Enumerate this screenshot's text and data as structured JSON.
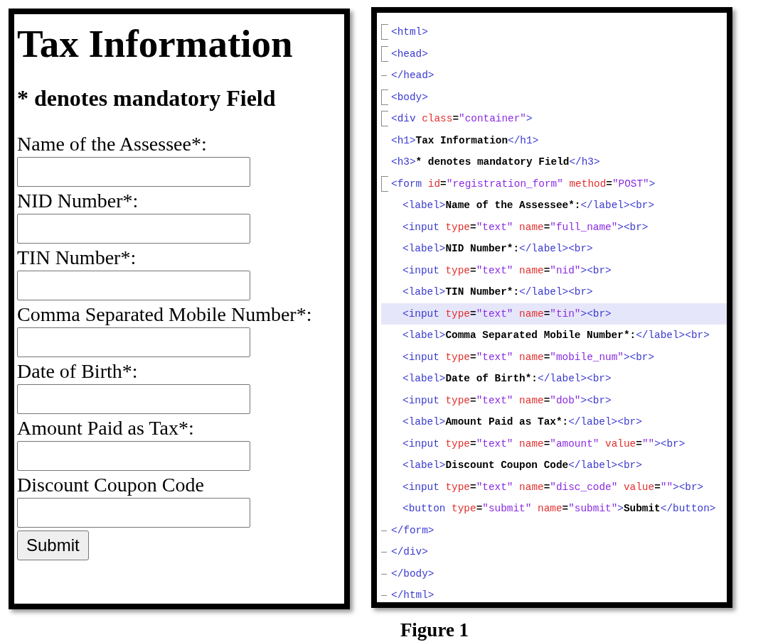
{
  "form_preview": {
    "title": "Tax Information",
    "subtitle": "* denotes mandatory Field",
    "fields": [
      {
        "label": "Name of the Assessee*:"
      },
      {
        "label": "NID Number*:"
      },
      {
        "label": "TIN Number*:"
      },
      {
        "label": "Comma Separated Mobile Number*:"
      },
      {
        "label": "Date of Birth*:"
      },
      {
        "label": "Amount Paid as Tax*:"
      },
      {
        "label": "Discount Coupon Code"
      }
    ],
    "submit_button": "Submit"
  },
  "code_editor": {
    "lines": [
      {
        "kind": "fold-start",
        "highlighted": false,
        "tokens": [
          {
            "kind": "tag",
            "text": "<html>"
          }
        ]
      },
      {
        "kind": "fold-start",
        "highlighted": false,
        "tokens": [
          {
            "kind": "tag",
            "text": "<head>"
          }
        ]
      },
      {
        "kind": "fold-end",
        "highlighted": false,
        "tokens": [
          {
            "kind": "tag",
            "text": "</head>"
          }
        ]
      },
      {
        "kind": "fold-start",
        "highlighted": false,
        "tokens": [
          {
            "kind": "tag",
            "text": "<body>"
          }
        ]
      },
      {
        "kind": "fold-start",
        "highlighted": false,
        "tokens": [
          {
            "kind": "tag",
            "text": "<div"
          },
          {
            "kind": "attr",
            "text": " class"
          },
          {
            "kind": "text",
            "text": "="
          },
          {
            "kind": "value",
            "text": "\"container\""
          },
          {
            "kind": "tag",
            "text": ">"
          }
        ]
      },
      {
        "highlighted": false,
        "tokens": [
          {
            "kind": "tag",
            "text": "<h1>"
          },
          {
            "kind": "text",
            "text": "Tax Information"
          },
          {
            "kind": "tag",
            "text": "</h1>"
          }
        ]
      },
      {
        "highlighted": false,
        "tokens": [
          {
            "kind": "tag",
            "text": "<h3>"
          },
          {
            "kind": "text",
            "text": "* denotes mandatory Field"
          },
          {
            "kind": "tag",
            "text": "</h3>"
          }
        ]
      },
      {
        "kind": "fold-start",
        "highlighted": false,
        "tokens": [
          {
            "kind": "tag",
            "text": "<form"
          },
          {
            "kind": "attr",
            "text": " id"
          },
          {
            "kind": "text",
            "text": "="
          },
          {
            "kind": "value",
            "text": "\"registration_form\""
          },
          {
            "kind": "attr",
            "text": " method"
          },
          {
            "kind": "text",
            "text": "="
          },
          {
            "kind": "value",
            "text": "\"POST\""
          },
          {
            "kind": "tag",
            "text": ">"
          }
        ],
        "children": [
          {
            "highlighted": false,
            "tokens": [
              {
                "kind": "tag",
                "text": "<label>"
              },
              {
                "kind": "text",
                "text": "Name of the Assessee*:"
              },
              {
                "kind": "tag",
                "text": "</label><br>"
              }
            ]
          },
          {
            "highlighted": false,
            "tokens": [
              {
                "kind": "tag",
                "text": "<input"
              },
              {
                "kind": "attr",
                "text": " type"
              },
              {
                "kind": "text",
                "text": "="
              },
              {
                "kind": "value",
                "text": "\"text\""
              },
              {
                "kind": "attr",
                "text": " name"
              },
              {
                "kind": "text",
                "text": "="
              },
              {
                "kind": "value",
                "text": "\"full_name\""
              },
              {
                "kind": "tag",
                "text": "><br>"
              }
            ]
          },
          {
            "highlighted": false,
            "tokens": [
              {
                "kind": "tag",
                "text": "<label>"
              },
              {
                "kind": "text",
                "text": "NID Number*:"
              },
              {
                "kind": "tag",
                "text": "</label><br>"
              }
            ]
          },
          {
            "highlighted": false,
            "tokens": [
              {
                "kind": "tag",
                "text": "<input"
              },
              {
                "kind": "attr",
                "text": " type"
              },
              {
                "kind": "text",
                "text": "="
              },
              {
                "kind": "value",
                "text": "\"text\""
              },
              {
                "kind": "attr",
                "text": " name"
              },
              {
                "kind": "text",
                "text": "="
              },
              {
                "kind": "value",
                "text": "\"nid\""
              },
              {
                "kind": "tag",
                "text": "><br>"
              }
            ]
          },
          {
            "highlighted": false,
            "tokens": [
              {
                "kind": "tag",
                "text": "<label>"
              },
              {
                "kind": "text",
                "text": "TIN Number*:"
              },
              {
                "kind": "tag",
                "text": "</label><br>"
              }
            ]
          },
          {
            "highlighted": true,
            "tokens": [
              {
                "kind": "tag",
                "text": "<input"
              },
              {
                "kind": "attr",
                "text": " type"
              },
              {
                "kind": "text",
                "text": "="
              },
              {
                "kind": "value",
                "text": "\"text\""
              },
              {
                "kind": "attr",
                "text": " name"
              },
              {
                "kind": "text",
                "text": "="
              },
              {
                "kind": "value",
                "text": "\"tin\""
              },
              {
                "kind": "tag",
                "text": "><br>"
              }
            ]
          },
          {
            "highlighted": false,
            "tokens": [
              {
                "kind": "tag",
                "text": "<label>"
              },
              {
                "kind": "text",
                "text": "Comma Separated Mobile Number*:"
              },
              {
                "kind": "tag",
                "text": "</label><br>"
              }
            ]
          },
          {
            "highlighted": false,
            "tokens": [
              {
                "kind": "tag",
                "text": "<input"
              },
              {
                "kind": "attr",
                "text": " type"
              },
              {
                "kind": "text",
                "text": "="
              },
              {
                "kind": "value",
                "text": "\"text\""
              },
              {
                "kind": "attr",
                "text": " name"
              },
              {
                "kind": "text",
                "text": "="
              },
              {
                "kind": "value",
                "text": "\"mobile_num\""
              },
              {
                "kind": "tag",
                "text": "><br>"
              }
            ]
          },
          {
            "highlighted": false,
            "tokens": [
              {
                "kind": "tag",
                "text": "<label>"
              },
              {
                "kind": "text",
                "text": "Date of Birth*:"
              },
              {
                "kind": "tag",
                "text": "</label><br>"
              }
            ]
          },
          {
            "highlighted": false,
            "tokens": [
              {
                "kind": "tag",
                "text": "<input"
              },
              {
                "kind": "attr",
                "text": " type"
              },
              {
                "kind": "text",
                "text": "="
              },
              {
                "kind": "value",
                "text": "\"text\""
              },
              {
                "kind": "attr",
                "text": " name"
              },
              {
                "kind": "text",
                "text": "="
              },
              {
                "kind": "value",
                "text": "\"dob\""
              },
              {
                "kind": "tag",
                "text": "><br>"
              }
            ]
          },
          {
            "highlighted": false,
            "tokens": [
              {
                "kind": "tag",
                "text": "<label>"
              },
              {
                "kind": "text",
                "text": "Amount Paid as Tax*:"
              },
              {
                "kind": "tag",
                "text": "</label><br>"
              }
            ]
          },
          {
            "highlighted": false,
            "tokens": [
              {
                "kind": "tag",
                "text": "<input"
              },
              {
                "kind": "attr",
                "text": " type"
              },
              {
                "kind": "text",
                "text": "="
              },
              {
                "kind": "value",
                "text": "\"text\""
              },
              {
                "kind": "attr",
                "text": " name"
              },
              {
                "kind": "text",
                "text": "="
              },
              {
                "kind": "value",
                "text": "\"amount\""
              },
              {
                "kind": "attr",
                "text": " value"
              },
              {
                "kind": "text",
                "text": "="
              },
              {
                "kind": "value",
                "text": "\"\""
              },
              {
                "kind": "tag",
                "text": "><br>"
              }
            ]
          },
          {
            "highlighted": false,
            "tokens": [
              {
                "kind": "tag",
                "text": "<label>"
              },
              {
                "kind": "text",
                "text": "Discount Coupon Code"
              },
              {
                "kind": "tag",
                "text": "</label><br>"
              }
            ]
          },
          {
            "highlighted": false,
            "tokens": [
              {
                "kind": "tag",
                "text": "<input"
              },
              {
                "kind": "attr",
                "text": " type"
              },
              {
                "kind": "text",
                "text": "="
              },
              {
                "kind": "value",
                "text": "\"text\""
              },
              {
                "kind": "attr",
                "text": " name"
              },
              {
                "kind": "text",
                "text": "="
              },
              {
                "kind": "value",
                "text": "\"disc_code\""
              },
              {
                "kind": "attr",
                "text": " value"
              },
              {
                "kind": "text",
                "text": "="
              },
              {
                "kind": "value",
                "text": "\"\""
              },
              {
                "kind": "tag",
                "text": "><br>"
              }
            ]
          },
          {
            "highlighted": false,
            "tokens": [
              {
                "kind": "tag",
                "text": "<button"
              },
              {
                "kind": "attr",
                "text": " type"
              },
              {
                "kind": "text",
                "text": "="
              },
              {
                "kind": "value",
                "text": "\"submit\""
              },
              {
                "kind": "attr",
                "text": " name"
              },
              {
                "kind": "text",
                "text": "="
              },
              {
                "kind": "value",
                "text": "\"submit\""
              },
              {
                "kind": "tag",
                "text": ">"
              },
              {
                "kind": "text",
                "text": "Submit"
              },
              {
                "kind": "tag",
                "text": "</button>"
              }
            ]
          }
        ]
      },
      {
        "kind": "fold-end",
        "highlighted": false,
        "tokens": [
          {
            "kind": "tag",
            "text": "</form>"
          }
        ]
      },
      {
        "kind": "fold-end",
        "highlighted": false,
        "tokens": [
          {
            "kind": "tag",
            "text": "</div>"
          }
        ]
      },
      {
        "kind": "fold-end",
        "highlighted": false,
        "tokens": [
          {
            "kind": "tag",
            "text": "</body>"
          }
        ]
      },
      {
        "kind": "fold-end",
        "highlighted": false,
        "tokens": [
          {
            "kind": "tag",
            "text": "</html>"
          }
        ]
      }
    ]
  },
  "caption": "Figure 1"
}
